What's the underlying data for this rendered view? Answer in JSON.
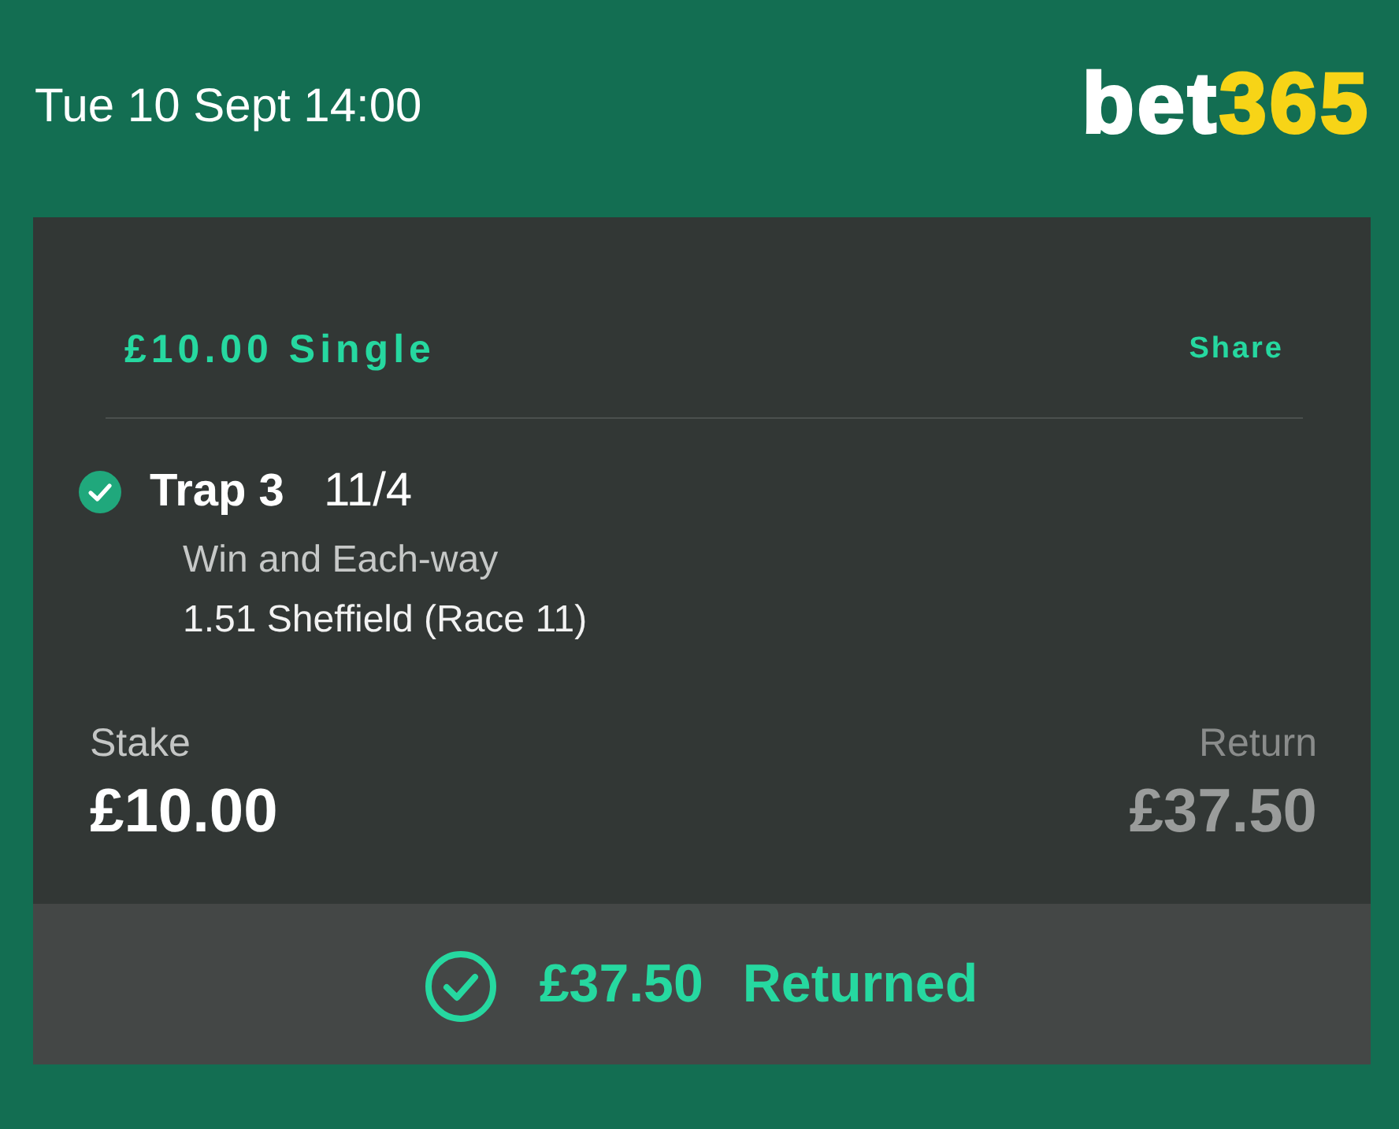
{
  "header": {
    "datetime": "Tue 10 Sept 14:00",
    "logo": {
      "part_1": "bet",
      "part_2": "365"
    }
  },
  "bet": {
    "title": "£10.00 Single",
    "share": "Share",
    "selection": {
      "won": true,
      "name": "Trap 3",
      "odds": "11/4",
      "market": "Win and Each-way",
      "event": "1.51 Sheffield (Race 11)"
    },
    "stake": {
      "label": "Stake",
      "value": "£10.00"
    },
    "return": {
      "label": "Return",
      "value": "£37.50"
    },
    "result": {
      "returned": true,
      "amount": "£37.50",
      "label": "Returned"
    }
  }
}
